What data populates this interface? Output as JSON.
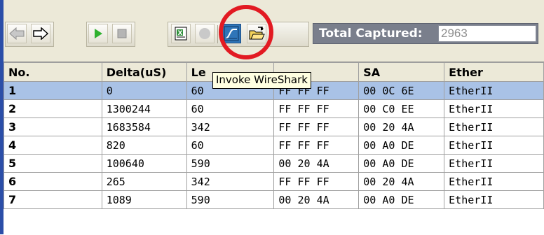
{
  "toolbar": {
    "buttons": [
      {
        "name": "back-arrow-icon"
      },
      {
        "name": "forward-arrow-icon"
      },
      {
        "name": "play-icon"
      },
      {
        "name": "stop-icon"
      },
      {
        "name": "excel-export-icon"
      },
      {
        "name": "record-icon"
      },
      {
        "name": "wireshark-icon"
      },
      {
        "name": "open-folder-icon"
      }
    ],
    "total_label": "Total Captured:",
    "total_value": "2963",
    "tooltip": "Invoke WireShark"
  },
  "colors": {
    "accent_blue": "#2b4ea8",
    "highlight_red": "#e21a22",
    "selected_row": "#a9c2e6",
    "play_green": "#2fb12f"
  },
  "table": {
    "columns": [
      "No.",
      "Delta(uS)",
      "Le",
      "",
      "SA",
      "Ether"
    ],
    "rows": [
      {
        "no": "1",
        "delta": "0",
        "len": "60",
        "da": "FF  FF  FF",
        "sa": "00  0C  6E",
        "ether": "EtherII",
        "selected": true
      },
      {
        "no": "2",
        "delta": "1300244",
        "len": "60",
        "da": "FF  FF  FF",
        "sa": "00  C0  EE",
        "ether": "EtherII"
      },
      {
        "no": "3",
        "delta": "1683584",
        "len": "342",
        "da": "FF  FF  FF",
        "sa": "00  20  4A",
        "ether": "EtherII"
      },
      {
        "no": "4",
        "delta": "820",
        "len": "60",
        "da": "FF  FF  FF",
        "sa": "00  A0  DE",
        "ether": "EtherII"
      },
      {
        "no": "5",
        "delta": "100640",
        "len": "590",
        "da": "00  20  4A",
        "sa": "00  A0  DE",
        "ether": "EtherII"
      },
      {
        "no": "6",
        "delta": "265",
        "len": "342",
        "da": "FF  FF  FF",
        "sa": "00  20  4A",
        "ether": "EtherII"
      },
      {
        "no": "7",
        "delta": "1089",
        "len": "590",
        "da": "00  20  4A",
        "sa": "00  A0  DE",
        "ether": "EtherII"
      }
    ]
  }
}
